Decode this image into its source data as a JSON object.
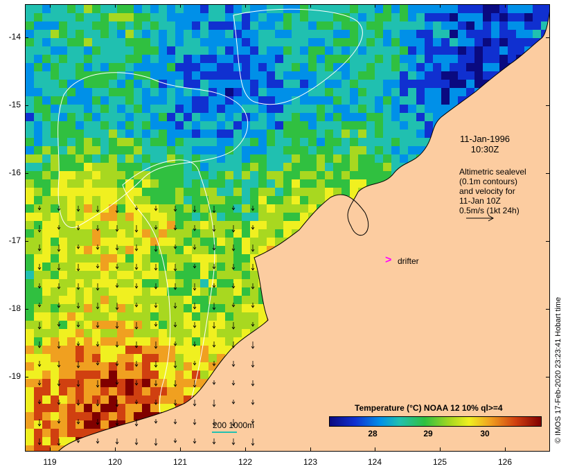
{
  "map": {
    "lat_ticks": [
      "-14",
      "-15",
      "-16",
      "-17",
      "-18",
      "-19"
    ],
    "lon_ticks": [
      "119",
      "120",
      "121",
      "122",
      "123",
      "124",
      "125",
      "126"
    ],
    "lat_range": [
      -20.08,
      -13.55
    ],
    "lon_range": [
      118.63,
      126.72
    ]
  },
  "annotations": {
    "date": "11-Jan-1996",
    "time": "10:30Z",
    "alt_line1": "Altimetric sealevel",
    "alt_line2": "(0.1m contours)",
    "alt_line3": "and velocity for",
    "alt_line4": "11-Jan 10Z",
    "alt_line5": "0.5m/s (1kt 24h)",
    "drifter_symbol": ">",
    "drifter_label": "drifter",
    "scale_label": "200  1000m"
  },
  "legend": {
    "title": "Temperature (°C) NOAA 12 10% ql>=4",
    "ticks": [
      "28",
      "29",
      "30"
    ],
    "tick_values": [
      28,
      29,
      30
    ],
    "range": [
      27.0,
      30.85
    ]
  },
  "credit": "© IMOS 17-Feb-2020 23:23:41 Hobart time",
  "colors": {
    "land": "#fccca0",
    "coast": "#000000",
    "sst_low": "#0a0a80",
    "sst_high": "#800000",
    "contour": "#ffffff",
    "drifter": "#ff00ff",
    "bathymetry": "#22c0b0"
  }
}
